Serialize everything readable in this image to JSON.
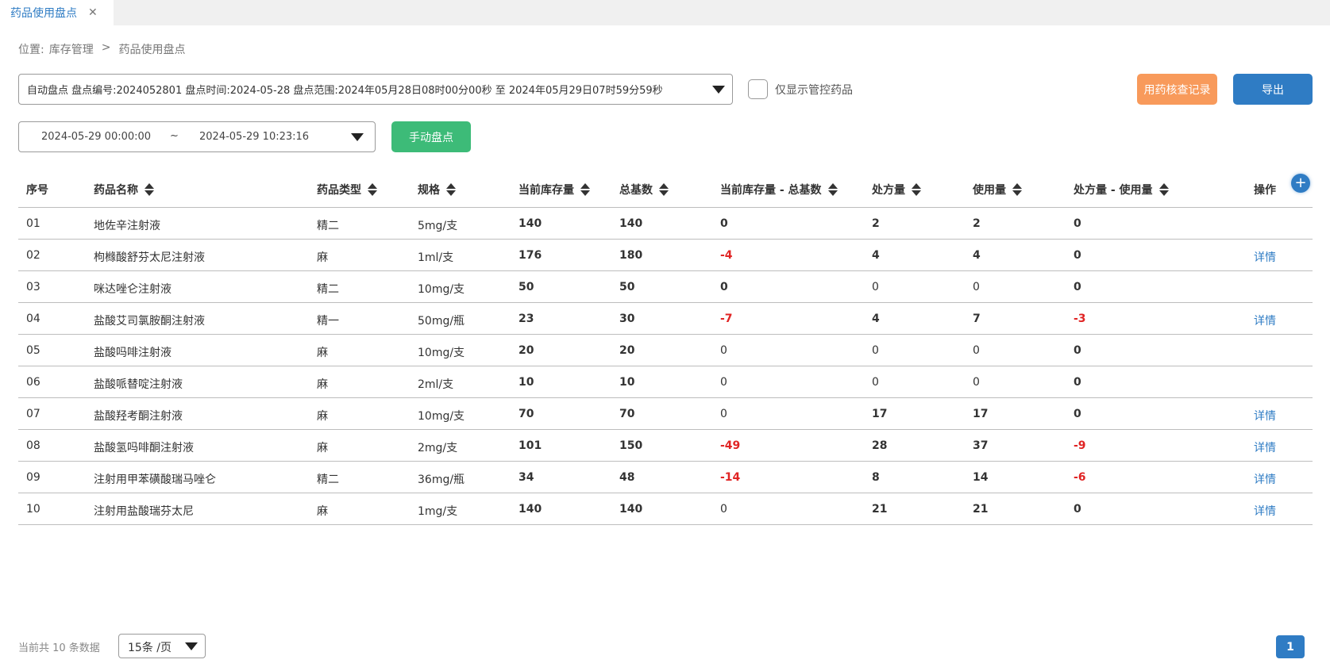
{
  "tab": {
    "label": "药品使用盘点",
    "close": "✕"
  },
  "breadcrumb": {
    "prefix": "位置:",
    "parent": "库存管理",
    "sep": ">",
    "current": "药品使用盘点"
  },
  "plan_select": {
    "value": "自动盘点 盘点编号:2024052801 盘点时间:2024-05-28 盘点范围:2024年05月28日08时00分00秒 至 2024年05月29日07时59分59秒"
  },
  "filter": {
    "controlled_only_label": "仅显示管控药品"
  },
  "buttons": {
    "check_record": "用药核查记录",
    "export": "导出",
    "manual": "手动盘点"
  },
  "date_range": {
    "start": "2024-05-29 00:00:00",
    "tilde": "~",
    "end": "2024-05-29 10:23:16"
  },
  "table": {
    "columns": [
      "序号",
      "药品名称",
      "药品类型",
      "规格",
      "当前库存量",
      "总基数",
      "当前库存量 - 总基数",
      "处方量",
      "使用量",
      "处方量 - 使用量",
      "操作"
    ],
    "add_icon": "+",
    "detail_label": "详情",
    "rows": [
      {
        "no": "01",
        "name": "地佐辛注射液",
        "type": "精二",
        "spec": "5mg/支",
        "stock": "140",
        "base": "140",
        "diff": "0",
        "rx": "2",
        "used": "2",
        "diff2": "0",
        "detail": ""
      },
      {
        "no": "02",
        "name": "枸橼酸舒芬太尼注射液",
        "type": "麻",
        "spec": "1ml/支",
        "stock": "176",
        "base": "180",
        "diff": "-4",
        "rx": "4",
        "used": "4",
        "diff2": "0",
        "detail": "详情"
      },
      {
        "no": "03",
        "name": "咪达唑仑注射液",
        "type": "精二",
        "spec": "10mg/支",
        "stock": "50",
        "base": "50",
        "diff": "0",
        "rx": "0",
        "used": "0",
        "diff2": "0",
        "detail": ""
      },
      {
        "no": "04",
        "name": "盐酸艾司氯胺酮注射液",
        "type": "精一",
        "spec": "50mg/瓶",
        "stock": "23",
        "base": "30",
        "diff": "-7",
        "rx": "4",
        "used": "7",
        "diff2": "-3",
        "detail": "详情"
      },
      {
        "no": "05",
        "name": "盐酸吗啡注射液",
        "type": "麻",
        "spec": "10mg/支",
        "stock": "20",
        "base": "20",
        "diff": "0",
        "rx": "0",
        "used": "0",
        "diff2": "0",
        "detail": ""
      },
      {
        "no": "06",
        "name": "盐酸哌替啶注射液",
        "type": "麻",
        "spec": "2ml/支",
        "stock": "10",
        "base": "10",
        "diff": "0",
        "rx": "0",
        "used": "0",
        "diff2": "0",
        "detail": ""
      },
      {
        "no": "07",
        "name": "盐酸羟考酮注射液",
        "type": "麻",
        "spec": "10mg/支",
        "stock": "70",
        "base": "70",
        "diff": "0",
        "rx": "17",
        "used": "17",
        "diff2": "0",
        "detail": "详情"
      },
      {
        "no": "08",
        "name": "盐酸氢吗啡酮注射液",
        "type": "麻",
        "spec": "2mg/支",
        "stock": "101",
        "base": "150",
        "diff": "-49",
        "rx": "28",
        "used": "37",
        "diff2": "-9",
        "detail": "详情"
      },
      {
        "no": "09",
        "name": "注射用甲苯磺酸瑞马唑仑",
        "type": "精二",
        "spec": "36mg/瓶",
        "stock": "34",
        "base": "48",
        "diff": "-14",
        "rx": "8",
        "used": "14",
        "diff2": "-6",
        "detail": "详情"
      },
      {
        "no": "10",
        "name": "注射用盐酸瑞芬太尼",
        "type": "麻",
        "spec": "1mg/支",
        "stock": "140",
        "base": "140",
        "diff": "0",
        "rx": "21",
        "used": "21",
        "diff2": "0",
        "detail": "详情"
      }
    ]
  },
  "footer": {
    "total": "当前共 10 条数据",
    "page_size": "15条 /页",
    "current_page": "1"
  },
  "colors": {
    "accent": "#2f7cc4",
    "orange": "#f89a5b",
    "green": "#3dbb78",
    "negative": "#e02424"
  }
}
